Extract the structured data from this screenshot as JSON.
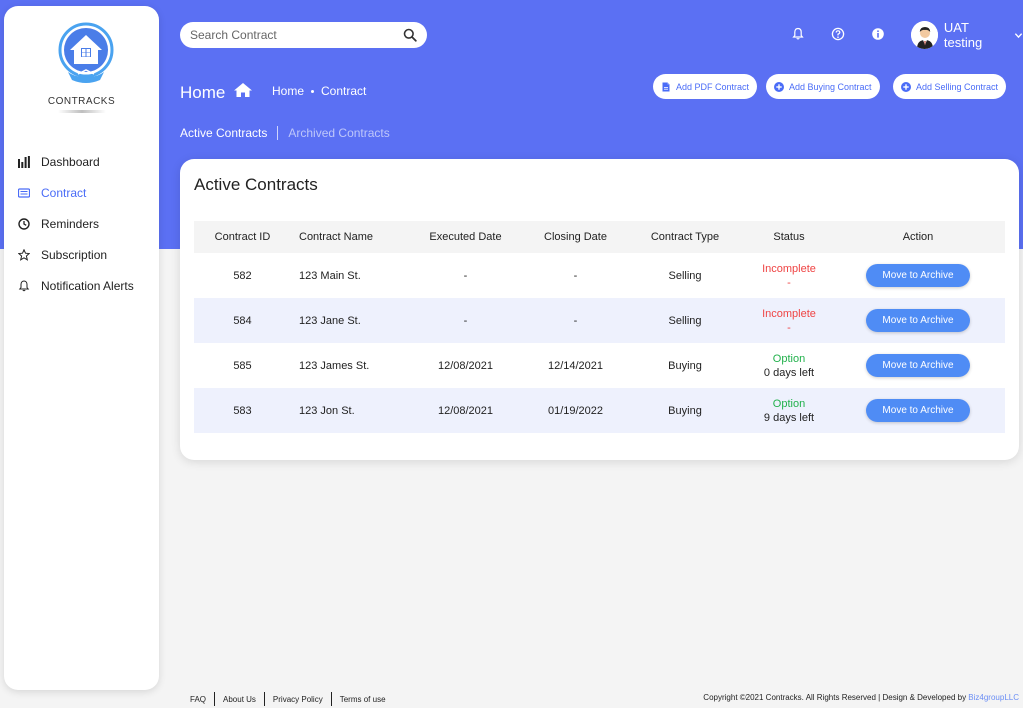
{
  "sidebar": {
    "logo_text": "CONTRACKS",
    "items": [
      {
        "label": "Dashboard",
        "icon": "bar-chart-icon"
      },
      {
        "label": "Contract",
        "icon": "contract-icon"
      },
      {
        "label": "Reminders",
        "icon": "clock-icon"
      },
      {
        "label": "Subscription",
        "icon": "star-icon"
      },
      {
        "label": "Notification Alerts",
        "icon": "bell-icon"
      }
    ],
    "active_index": 1
  },
  "topbar": {
    "search_placeholder": "Search Contract",
    "user_name": "UAT testing"
  },
  "header": {
    "title": "Home",
    "breadcrumb": [
      "Home",
      "Contract"
    ],
    "actions": [
      "Add PDF Contract",
      "Add Buying Contract",
      "Add Selling Contract"
    ]
  },
  "tabs": [
    "Active Contracts",
    "Archived Contracts"
  ],
  "card": {
    "title": "Active Contracts",
    "columns": [
      "Contract ID",
      "Contract Name",
      "Executed Date",
      "Closing Date",
      "Contract Type",
      "Status",
      "Action"
    ],
    "rows": [
      {
        "id": "582",
        "name": "123 Main St.",
        "executed": "-",
        "closing": "-",
        "type": "Selling",
        "status": "Incomplete",
        "status_detail": "-",
        "action": "Move to Archive"
      },
      {
        "id": "584",
        "name": "123 Jane St.",
        "executed": "-",
        "closing": "-",
        "type": "Selling",
        "status": "Incomplete",
        "status_detail": "-",
        "action": "Move to Archive"
      },
      {
        "id": "585",
        "name": "123 James St.",
        "executed": "12/08/2021",
        "closing": "12/14/2021",
        "type": "Buying",
        "status": "Option",
        "status_detail": "0 days left",
        "action": "Move to Archive"
      },
      {
        "id": "583",
        "name": "123 Jon St.",
        "executed": "12/08/2021",
        "closing": "01/19/2022",
        "type": "Buying",
        "status": "Option",
        "status_detail": "9 days left",
        "action": "Move to Archive"
      }
    ]
  },
  "footer": {
    "links": [
      "FAQ",
      "About Us",
      "Privacy Policy",
      "Terms of use"
    ],
    "copyright": "Copyright ©2021 Contracks. All Rights Reserved | Design & Developed by ",
    "developer": "Biz4groupLLC"
  },
  "colors": {
    "hero": "#5b70f3",
    "accent": "#4a6cf7",
    "archive_button": "#4f8cf5",
    "incomplete": "#ef4444",
    "option": "#22b14c"
  }
}
